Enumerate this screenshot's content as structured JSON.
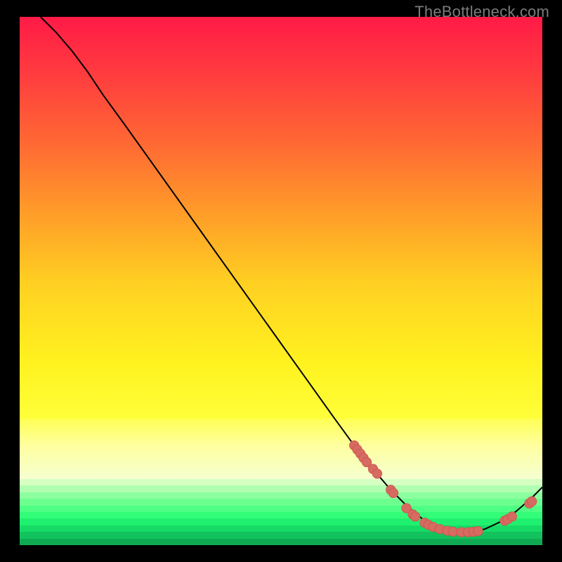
{
  "watermark": "TheBottleneck.com",
  "colors": {
    "green_bands": [
      "#d6ffc2",
      "#b0ffb0",
      "#8cff9e",
      "#6cff90",
      "#4dff82",
      "#33fd78",
      "#1ff06f",
      "#16da66",
      "#12c25c",
      "#0fab53"
    ],
    "curve_stroke": "#000000",
    "marker_fill": "#d76a61",
    "marker_stroke": "#c8584f"
  },
  "chart_data": {
    "type": "line",
    "title": "",
    "xlabel": "",
    "ylabel": "",
    "xlim": [
      0,
      100
    ],
    "ylim": [
      0,
      100
    ],
    "curve": [
      [
        4,
        100
      ],
      [
        7,
        97
      ],
      [
        10,
        93.5
      ],
      [
        13,
        89.5
      ],
      [
        16,
        85
      ],
      [
        20,
        79.5
      ],
      [
        25,
        72.5
      ],
      [
        30,
        65.5
      ],
      [
        35,
        58.5
      ],
      [
        40,
        51.5
      ],
      [
        45,
        44.5
      ],
      [
        50,
        37.5
      ],
      [
        55,
        30.5
      ],
      [
        60,
        23.5
      ],
      [
        64,
        18
      ],
      [
        68,
        13
      ],
      [
        71,
        9.5
      ],
      [
        74,
        6.5
      ],
      [
        77,
        4
      ],
      [
        80,
        2.2
      ],
      [
        83,
        1.4
      ],
      [
        86,
        1.3
      ],
      [
        89,
        2
      ],
      [
        92,
        3.4
      ],
      [
        95,
        5.4
      ],
      [
        98,
        8
      ],
      [
        100,
        10
      ]
    ],
    "markers": [
      [
        64.0,
        18.0
      ],
      [
        64.6,
        17.2
      ],
      [
        65.2,
        16.4
      ],
      [
        65.8,
        15.6
      ],
      [
        66.4,
        14.8
      ],
      [
        67.6,
        13.5
      ],
      [
        68.4,
        12.6
      ],
      [
        71.0,
        9.5
      ],
      [
        71.5,
        8.9
      ],
      [
        74.0,
        6.0
      ],
      [
        75.2,
        4.8
      ],
      [
        75.7,
        4.4
      ],
      [
        77.5,
        3.2
      ],
      [
        78.2,
        2.8
      ],
      [
        79.1,
        2.4
      ],
      [
        80.4,
        2.0
      ],
      [
        81.8,
        1.7
      ],
      [
        82.9,
        1.5
      ],
      [
        84.5,
        1.4
      ],
      [
        85.8,
        1.4
      ],
      [
        86.8,
        1.5
      ],
      [
        87.7,
        1.6
      ],
      [
        92.8,
        3.6
      ],
      [
        93.4,
        3.9
      ],
      [
        94.2,
        4.4
      ],
      [
        97.5,
        6.9
      ],
      [
        98.0,
        7.3
      ]
    ]
  }
}
